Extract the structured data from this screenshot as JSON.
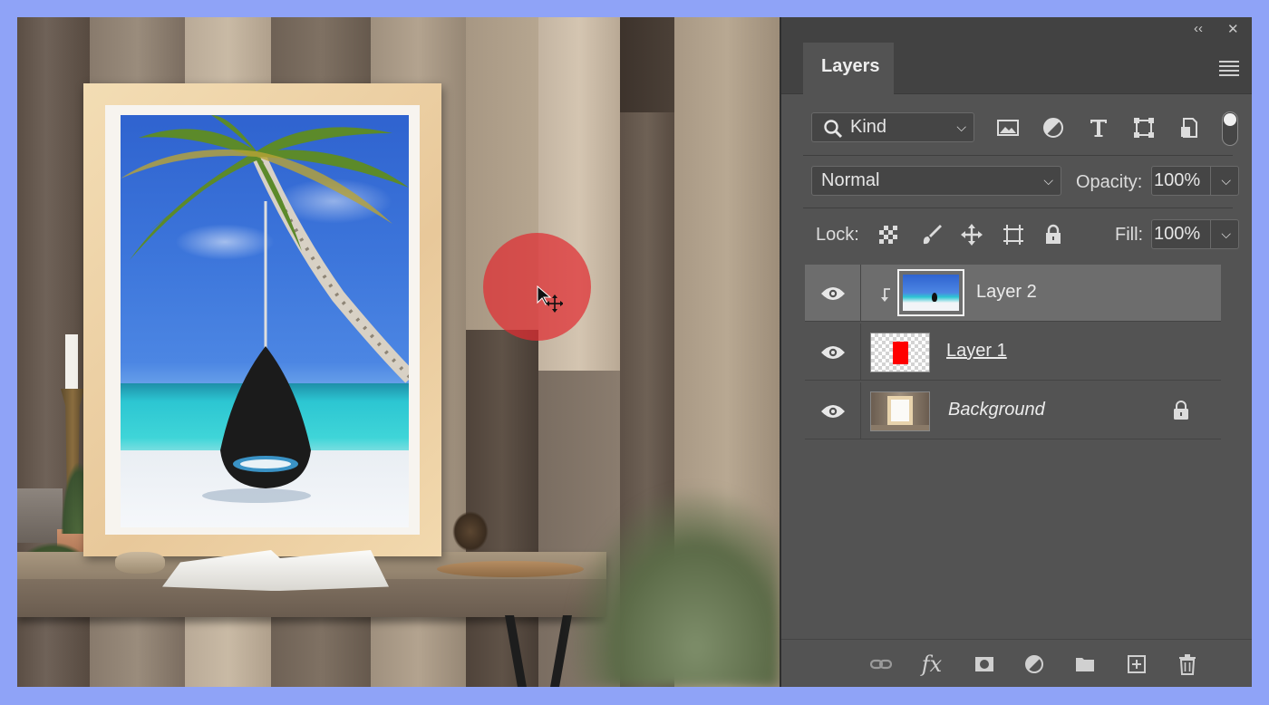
{
  "panel": {
    "topbar": {
      "collapse_glyph": "‹‹",
      "close_glyph": "✕"
    },
    "tab_label": "Layers",
    "filter": {
      "kind_label": "Kind",
      "icons": [
        "image-filter-icon",
        "adjustment-filter-icon",
        "type-filter-icon",
        "shape-filter-icon",
        "smart-object-filter-icon"
      ]
    },
    "blend": {
      "mode": "Normal",
      "opacity_label": "Opacity:",
      "opacity_value": "100%"
    },
    "lock": {
      "label": "Lock:",
      "fill_label": "Fill:",
      "fill_value": "100%"
    },
    "layers": [
      {
        "name": "Layer 2",
        "selected": true,
        "clipped": true
      },
      {
        "name": "Layer 1",
        "selected": false,
        "clipped": false
      },
      {
        "name": "Background",
        "selected": false,
        "clipped": false,
        "locked": true
      }
    ],
    "footer_icons": [
      "link-layers-icon",
      "fx-icon",
      "mask-icon",
      "adjustment-layer-icon",
      "group-folder-icon",
      "new-layer-icon",
      "trash-icon"
    ],
    "fx_label": "fx"
  },
  "colors": {
    "page_border": "#8fa3f7",
    "panel_bg": "#535353",
    "brush_cursor": "#e12d32",
    "layer1_fill": "#ff0000"
  }
}
